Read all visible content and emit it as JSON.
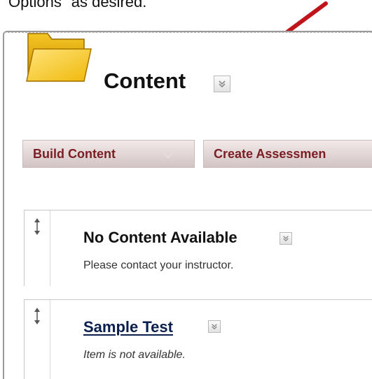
{
  "caption": "Options\" as desired.",
  "page": {
    "title": "Content"
  },
  "toolbar": {
    "build_content_label": "Build Content",
    "create_assessment_label": "Create Assessmen"
  },
  "items": [
    {
      "title": "No Content Available",
      "description": "Please contact your instructor."
    },
    {
      "title": "Sample Test",
      "description": "Item is not available."
    }
  ],
  "colors": {
    "arrow": "#c0141b",
    "button_text": "#7a1e24",
    "link": "#0b1f4e",
    "folder": "#f3c21a"
  },
  "icons": {
    "folder": "folder-icon",
    "menu": "chevron-down-icon",
    "drag": "drag-handle-icon",
    "annotation": "red-arrow-icon"
  }
}
